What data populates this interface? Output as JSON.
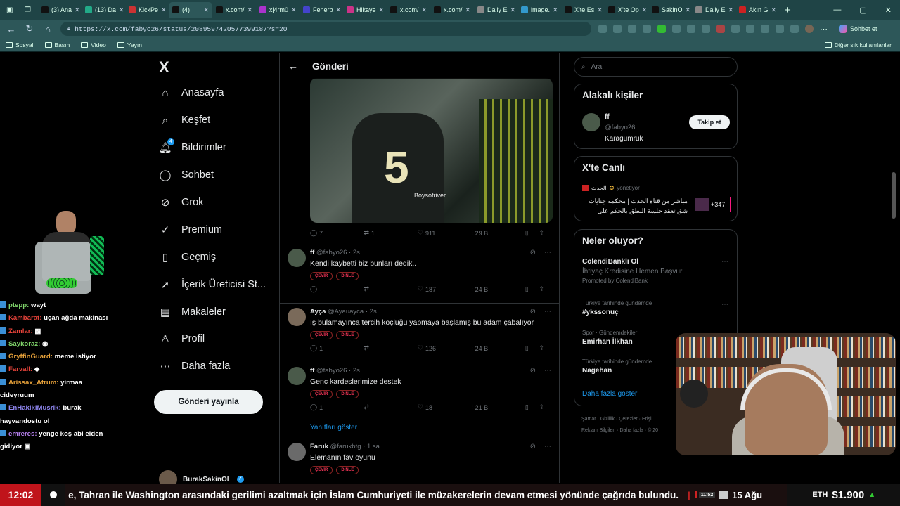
{
  "browser": {
    "tabs": [
      {
        "label": "(3) Ana",
        "color": "#111"
      },
      {
        "label": "(13) Da",
        "color": "#2a8"
      },
      {
        "label": "KickPe",
        "color": "#c33"
      },
      {
        "label": "(4)",
        "color": "#111"
      },
      {
        "label": "x.com/",
        "color": "#111"
      },
      {
        "label": "xj4rm0",
        "color": "#a3c"
      },
      {
        "label": "Fenerb",
        "color": "#44c"
      },
      {
        "label": "Hikaye",
        "color": "#c38"
      },
      {
        "label": "x.com/",
        "color": "#111"
      },
      {
        "label": "x.com/",
        "color": "#111"
      },
      {
        "label": "Daily E",
        "color": "#888"
      },
      {
        "label": "image.",
        "color": "#39c"
      },
      {
        "label": "X'te Es",
        "color": "#111"
      },
      {
        "label": "X'te Op",
        "color": "#111"
      },
      {
        "label": "SakinO",
        "color": "#111"
      },
      {
        "label": "Daily E",
        "color": "#888"
      },
      {
        "label": "Akın G",
        "color": "#c22"
      }
    ],
    "url": "https://x.com/fabyo26/status/2089597420577399187?s=20",
    "copilot_label": "Sohbet et",
    "bookmarks": [
      "Sosyal",
      "Basın",
      "Video",
      "Yayın"
    ],
    "other_bookmarks": "Diğer sık kullanılanlar"
  },
  "nav": {
    "logo": "X",
    "items": [
      {
        "label": "Anasayfa",
        "icon": "⌂"
      },
      {
        "label": "Keşfet",
        "icon": "⌕"
      },
      {
        "label": "Bildirimler",
        "icon": "🔔︎",
        "badge": "4"
      },
      {
        "label": "Sohbet",
        "icon": "◯"
      },
      {
        "label": "Grok",
        "icon": "⊘"
      },
      {
        "label": "Premium",
        "icon": "✓"
      },
      {
        "label": "Geçmiş",
        "icon": "▯"
      },
      {
        "label": "İçerik Üreticisi St...",
        "icon": "➚"
      },
      {
        "label": "Makaleler",
        "icon": "▤"
      },
      {
        "label": "Profil",
        "icon": "♙"
      },
      {
        "label": "Daha fazla",
        "icon": "⋯"
      }
    ],
    "post_button": "Gönderi yayınla",
    "account_name": "BurakSakinOl"
  },
  "main": {
    "header_title": "Gönderi",
    "video": {
      "number": "5",
      "watermark": "Boysofriver"
    },
    "main_post_stats": {
      "replies": "7",
      "reposts": "1",
      "likes": "911",
      "views": "29 B"
    },
    "replies": [
      {
        "name": "ff",
        "handle": "@fabyo26",
        "time": "2s",
        "text": "Kendi kaybetti biz bunları dedik..",
        "likes": "187",
        "views": "24 B",
        "replies": "",
        "reposts": "",
        "avatar": "#4a5a4a"
      },
      {
        "name": "Ayça",
        "handle": "@Ayauayca",
        "time": "2s",
        "text": "İş bulamayınca tercih koçluğu yapmaya başlamış bu adam çabalıyor",
        "likes": "126",
        "views": "24 B",
        "replies": "1",
        "reposts": "",
        "avatar": "#7a6a5a"
      },
      {
        "name": "ff",
        "handle": "@fabyo26",
        "time": "2s",
        "text": "Genc kardeslerimize destek",
        "likes": "18",
        "views": "21 B",
        "replies": "1",
        "reposts": "",
        "avatar": "#4a5a4a"
      },
      {
        "name": "Faruk",
        "handle": "@farukbtg",
        "time": "1 sa",
        "text": "Elemanın fav oyunu",
        "likes": "",
        "views": "",
        "replies": "",
        "reposts": "",
        "avatar": "#6a6a6a"
      }
    ],
    "chip_translate": "ÇEVİR",
    "chip_listen": "DİNLE",
    "show_replies": "Yanıtları göster"
  },
  "right": {
    "search_placeholder": "Ara",
    "related_title": "Alakalı kişiler",
    "related_name": "ff",
    "related_handle": "@fabyo26",
    "related_bio": "Karagümrük",
    "follow_label": "Takip et",
    "live_title": "X'te Canlı",
    "live_host": "الحدث",
    "live_host_role": "yönetiyor",
    "live_text_1": "مباشر من قناة الحدث | محكمة جنايات",
    "live_text_2": "شق تعقد جلسة النطق بالحكم على",
    "live_count": "+347",
    "trends_title": "Neler oluyor?",
    "trends": [
      {
        "context": "",
        "headline": "ColendiBanklı Ol",
        "sub": "İhtiyaç Kredisine Hemen Başvur",
        "promo": "Promoted by ColendiBank"
      },
      {
        "context": "Türkiye tarihinde gündemde",
        "headline": "#ykssonuç"
      },
      {
        "context": "Spor · Gündemdekiler",
        "headline": "Emirhan İlkhan"
      },
      {
        "context": "Türkiye tarihinde gündemde",
        "headline": "Nagehan"
      }
    ],
    "show_more": "Daha fazla göster",
    "footer_1": "Şartlar · Gizlilik · Çerezler · Erişi",
    "footer_2": "Reklam Bilgileri · Daha fazla · © 20"
  },
  "chat": [
    {
      "user": "ptepp:",
      "msg": "wayt",
      "color": "#7fd36a"
    },
    {
      "user": "Kambarat:",
      "msg": "uçan ağda makinası",
      "color": "#e6433a"
    },
    {
      "user": "Zamlar:",
      "msg": "▩",
      "color": "#e6433a"
    },
    {
      "user": "Saykoraz:",
      "msg": "◉",
      "color": "#7fd36a"
    },
    {
      "user": "GryffinGuard:",
      "msg": "meme istiyor",
      "color": "#e8a23a"
    },
    {
      "user": "Farvall:",
      "msg": "◆",
      "color": "#e6433a"
    },
    {
      "user": "Arissax_Atrum:",
      "msg": "yirmaa",
      "color": "#e8a23a"
    },
    {
      "user": "",
      "msg": "cideyruum",
      "color": "#fff"
    },
    {
      "user": "EnHakikiMusrik:",
      "msg": "burak",
      "color": "#8f86f0"
    },
    {
      "user": "",
      "msg": "hayvandostu ol",
      "color": "#fff"
    },
    {
      "user": "emreres:",
      "msg": "yenge koş abi elden",
      "color": "#b781f0"
    },
    {
      "user": "",
      "msg": "gidiyor ▣",
      "color": "#fff"
    }
  ],
  "ticker": {
    "time": "12:02",
    "headline": "e, Tahran ile Washington arasındaki gerilimi azaltmak için İslam Cumhuriyeti ile müzakerelerin devam etmesi yönünde çağrıda bulundu.",
    "time2": "11:52",
    "headline2": "15 Ağu",
    "eth_symbol": "ETH",
    "eth_price": "$1.900"
  }
}
